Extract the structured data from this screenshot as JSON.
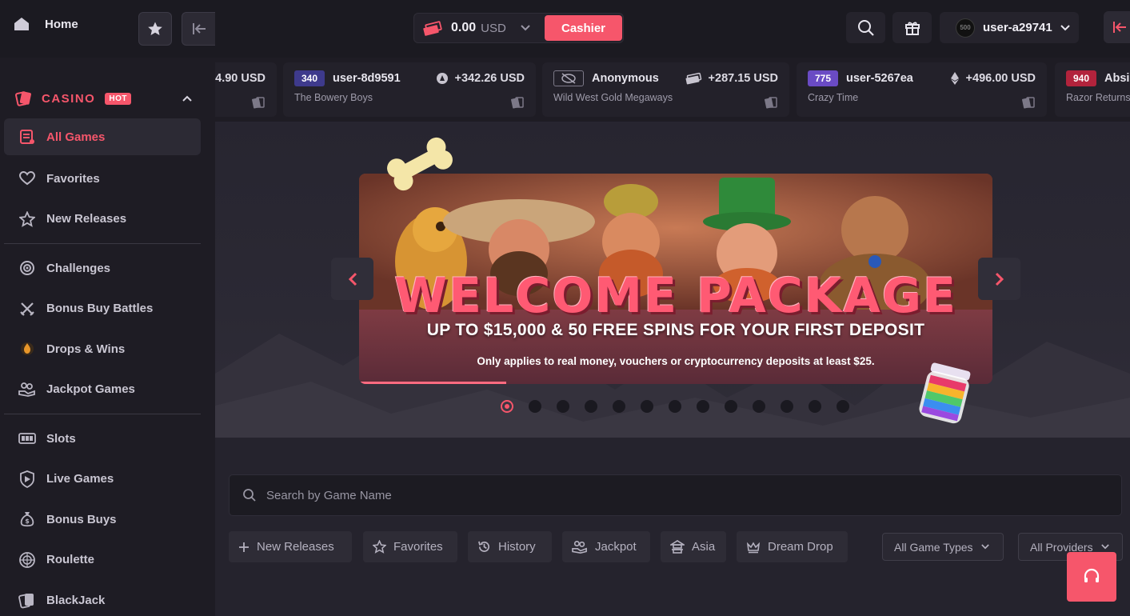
{
  "colors": {
    "accent": "#f6566b",
    "sidebar": "#1e1c24",
    "topbar": "#1b1a21",
    "page": "#25232d"
  },
  "sidebar": {
    "home_label": "Home",
    "casino_label": "CASINO",
    "hot_badge": "HOT",
    "items_group1": [
      {
        "label": "All Games",
        "icon": "list-icon"
      },
      {
        "label": "Favorites",
        "icon": "heart-icon"
      },
      {
        "label": "New Releases",
        "icon": "star-icon"
      }
    ],
    "items_group2": [
      {
        "label": "Challenges",
        "icon": "target-icon"
      },
      {
        "label": "Bonus Buy Battles",
        "icon": "swords-icon"
      },
      {
        "label": "Drops & Wins",
        "icon": "drops-wins-icon"
      },
      {
        "label": "Jackpot Games",
        "icon": "jackpot-icon"
      }
    ],
    "items_group3": [
      {
        "label": "Slots",
        "icon": "slots-icon"
      },
      {
        "label": "Live Games",
        "icon": "live-icon"
      },
      {
        "label": "Bonus Buys",
        "icon": "moneybag-icon"
      },
      {
        "label": "Roulette",
        "icon": "roulette-icon"
      },
      {
        "label": "BlackJack",
        "icon": "cards-icon"
      }
    ]
  },
  "topbar": {
    "balance": "0.00",
    "currency": "USD",
    "cashier_label": "Cashier",
    "username": "user-a29741",
    "level": "500"
  },
  "ticker": [
    {
      "badge": "",
      "user": "",
      "amount": ".90 USD",
      "amount_prefix": "4",
      "game": ""
    },
    {
      "badge": "340",
      "badge_color": "#3e3a8c",
      "user": "user-8d9591",
      "amount": "+342.26 USD",
      "game": "The Bowery Boys"
    },
    {
      "badge": "",
      "user": "Anonymous",
      "amount": "+287.15 USD",
      "game": "Wild West Gold Megaways"
    },
    {
      "badge": "775",
      "badge_color": "#6a4bc4",
      "user": "user-5267ea",
      "amount": "+496.00 USD",
      "game": "Crazy Time"
    },
    {
      "badge": "940",
      "badge_color": "#b2233c",
      "user": "Absi",
      "amount": "",
      "game": "Razor Returns"
    }
  ],
  "banner": {
    "title": "WELCOME PACKAGE",
    "subtitle": "UP TO $15,000 & 50 FREE SPINS FOR YOUR FIRST DEPOSIT",
    "note": "Only applies to real money, vouchers or cryptocurrency deposits at least $25.",
    "slide_count": 13,
    "active_slide": 1
  },
  "search": {
    "placeholder": "Search by Game Name"
  },
  "filters": [
    {
      "label": "New Releases",
      "icon": "plus-icon"
    },
    {
      "label": "Favorites",
      "icon": "star-icon"
    },
    {
      "label": "History",
      "icon": "history-icon"
    },
    {
      "label": "Jackpot",
      "icon": "jackpot-icon"
    },
    {
      "label": "Asia",
      "icon": "pagoda-icon"
    },
    {
      "label": "Dream Drop",
      "icon": "crown-icon"
    }
  ],
  "selects": {
    "game_types": "All Game Types",
    "providers": "All Providers"
  }
}
